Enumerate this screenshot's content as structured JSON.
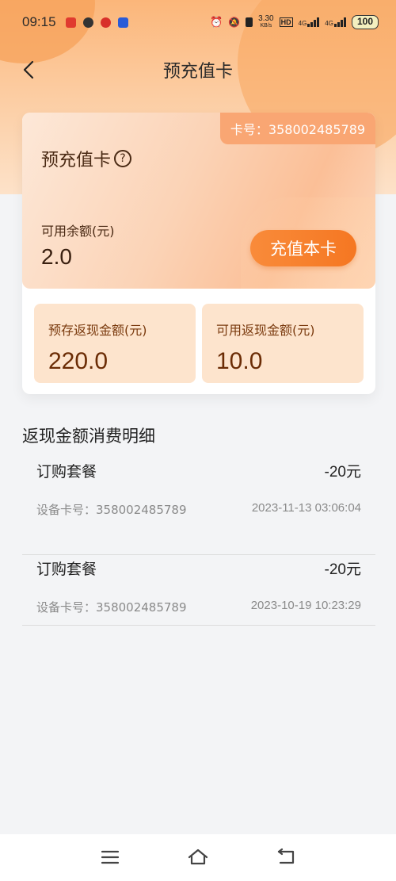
{
  "status_bar": {
    "time": "09:15",
    "speed": "3.30",
    "speed_unit": "KB/s",
    "net1": "4G",
    "net2": "4G",
    "battery": "100"
  },
  "nav": {
    "title": "预充值卡"
  },
  "card": {
    "card_number": "卡号：358002485789",
    "title": "预充值卡",
    "balance_label": "可用余额(元)",
    "balance_value": "2.0",
    "recharge_label": "充值本卡",
    "prestore_label": "预存返现金额(元)",
    "prestore_value": "220.0",
    "available_cashback_label": "可用返现金额(元)",
    "available_cashback_value": "10.0"
  },
  "section": {
    "title": "返现金额消费明细"
  },
  "records": [
    {
      "name": "订购套餐",
      "amount": "-20元",
      "device": "设备卡号：358002485789",
      "time": "2023-11-13 03:06:04"
    },
    {
      "name": "订购套餐",
      "amount": "-20元",
      "device": "设备卡号：358002485789",
      "time": "2023-10-19 10:23:29"
    }
  ],
  "colors": {
    "accent": "#f57722",
    "card_number_bg": "#f9a673",
    "sub_box_bg": "#fde4cd"
  },
  "icons": [
    "back-arrow-icon",
    "help-circle-icon",
    "menu-icon",
    "home-icon",
    "return-icon"
  ]
}
